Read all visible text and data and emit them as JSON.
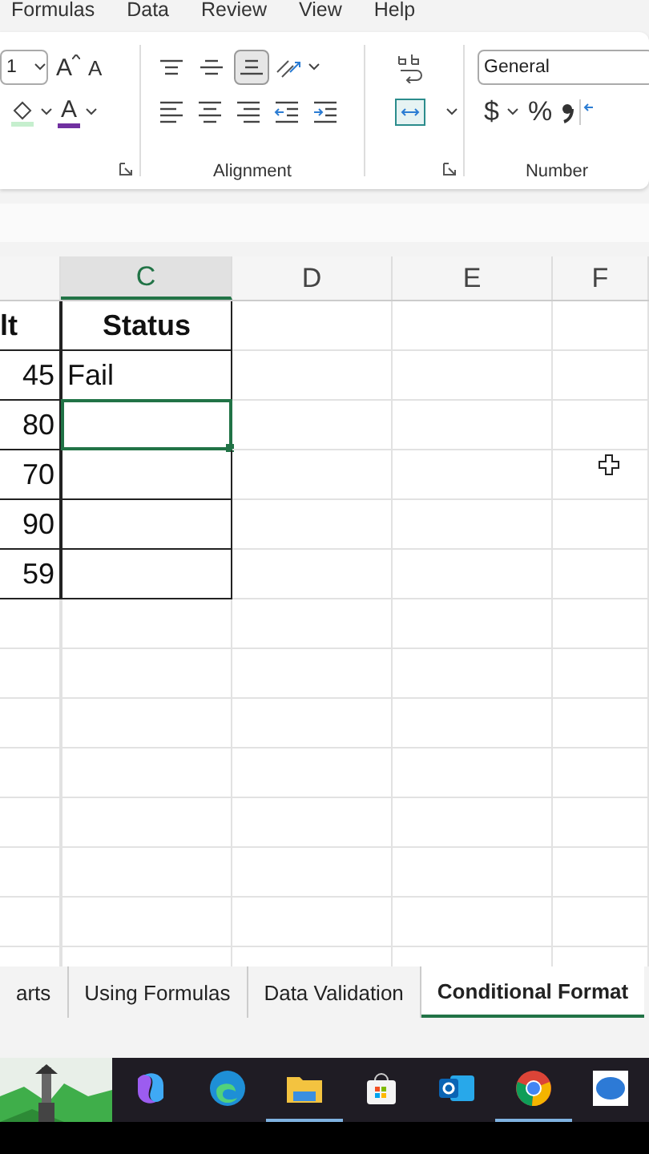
{
  "menu_tabs": [
    "Formulas",
    "Data",
    "Review",
    "View",
    "Help"
  ],
  "ribbon": {
    "font": {
      "size_value": "1",
      "grow_glyph": "A",
      "shrink_glyph": "A",
      "color_glyph": "A"
    },
    "alignment": {
      "label": "Alignment",
      "vertical": [
        {
          "kind": "top",
          "selected": false
        },
        {
          "kind": "middle",
          "selected": false
        },
        {
          "kind": "bottom",
          "selected": true
        }
      ],
      "horizontal": [
        {
          "kind": "left"
        },
        {
          "kind": "center"
        },
        {
          "kind": "right"
        },
        {
          "kind": "outdent"
        },
        {
          "kind": "indent"
        }
      ]
    },
    "number": {
      "label": "Number",
      "format_value": "General",
      "currency": "$",
      "percent": "%"
    }
  },
  "columns": [
    {
      "label": "C",
      "selected": true
    },
    {
      "label": "D",
      "selected": false
    },
    {
      "label": "E",
      "selected": false
    },
    {
      "label": "F",
      "selected": false
    }
  ],
  "rows": [
    {
      "kind": "header",
      "col_b": "lt",
      "col_c": "Status",
      "selected": false
    },
    {
      "kind": "data",
      "col_b": "45",
      "col_c": "Fail",
      "selected": false
    },
    {
      "kind": "data",
      "col_b": "80",
      "selected": true
    },
    {
      "kind": "data",
      "col_b": "70",
      "selected": false
    },
    {
      "kind": "data",
      "col_b": "90",
      "selected": false
    },
    {
      "kind": "data",
      "col_b": "59",
      "selected": false
    }
  ],
  "sheet_tabs": [
    {
      "label": "arts",
      "selected": false
    },
    {
      "label": "Using Formulas",
      "selected": false
    },
    {
      "label": "Data Validation",
      "selected": false
    },
    {
      "label": "Conditional Format",
      "selected": true
    }
  ],
  "taskbar": [
    {
      "kind": "swirl",
      "running": false
    },
    {
      "kind": "wave",
      "running": false
    },
    {
      "kind": "folder",
      "running": true
    },
    {
      "kind": "bag",
      "running": false
    },
    {
      "kind": "mail",
      "running": false
    },
    {
      "kind": "ring",
      "running": true
    },
    {
      "kind": "chat",
      "running": false
    }
  ]
}
